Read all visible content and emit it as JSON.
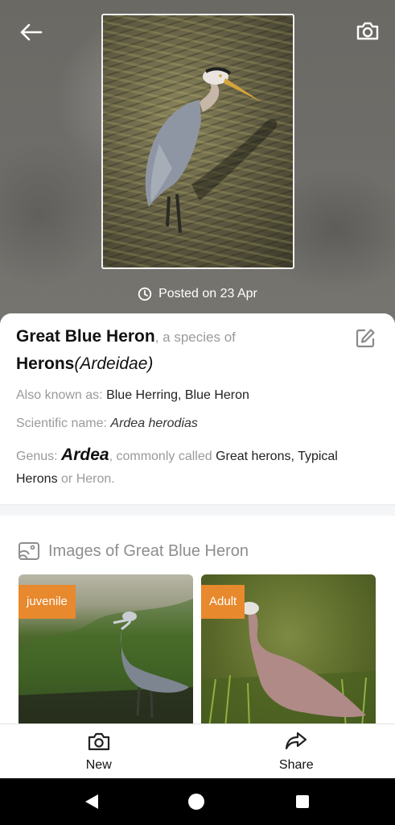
{
  "header": {
    "back_icon": "arrow-left-icon",
    "camera_icon": "camera-icon",
    "posted_icon": "clock-icon",
    "posted_text": "Posted on 23 Apr"
  },
  "species": {
    "name": "Great Blue Heron",
    "species_of_text": ", a species of",
    "family_common": "Herons",
    "family_scientific": "(Ardeidae)",
    "aka_label": "Also known as:",
    "aka_value": "Blue Herring, Blue Heron",
    "scientific_label": "Scientific name:",
    "scientific_value": "Ardea herodias",
    "genus_label": "Genus:",
    "genus_name": "Ardea",
    "genus_common_text": ", commonly called",
    "genus_common_names": "Great herons, Typical Herons",
    "genus_or_text": "or Heron.",
    "edit_icon": "edit-icon"
  },
  "images": {
    "header_icon": "image-gallery-icon",
    "title": "Images of Great Blue Heron",
    "items": [
      {
        "tag": "juvenile"
      },
      {
        "tag": "Adult"
      }
    ]
  },
  "bottom_bar": {
    "new_label": "New",
    "new_icon": "camera-icon",
    "share_label": "Share",
    "share_icon": "share-arrow-icon"
  },
  "colors": {
    "tag_background": "#e8892e",
    "hero_background": "#6f6d69"
  }
}
